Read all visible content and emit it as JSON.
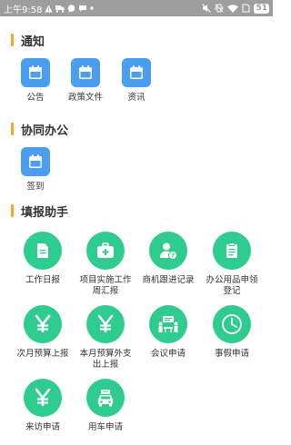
{
  "status_bar": {
    "time": "上午9:58",
    "battery": "51",
    "left_icons": [
      "warning-icon",
      "delivery-icon",
      "message-icon",
      "chat-icon",
      "more-dot-icon"
    ],
    "right_icons": [
      "mute-icon",
      "vibrate-icon",
      "wifi-icon",
      "sim-icon"
    ]
  },
  "sections": {
    "notice": {
      "title": "通知",
      "items": [
        {
          "label": "公告",
          "icon": "calendar-icon"
        },
        {
          "label": "政策文件",
          "icon": "calendar-icon"
        },
        {
          "label": "资讯",
          "icon": "calendar-icon"
        }
      ]
    },
    "office": {
      "title": "协同办公",
      "items": [
        {
          "label": "签到",
          "icon": "calendar-icon"
        }
      ]
    },
    "forms": {
      "title": "填报助手",
      "items": [
        {
          "label": "工作日报",
          "icon": "document-icon"
        },
        {
          "label": "项目实施工作周汇报",
          "icon": "medical-case-icon"
        },
        {
          "label": "商机跟进记录",
          "icon": "person-question-icon"
        },
        {
          "label": "办公用品申领登记",
          "icon": "clipboard-icon"
        },
        {
          "label": "次月预算上报",
          "icon": "yen-icon"
        },
        {
          "label": "本月预算外支出上报",
          "icon": "yen-icon"
        },
        {
          "label": "会议申请",
          "icon": "meeting-icon"
        },
        {
          "label": "事假申请",
          "icon": "clock-icon"
        },
        {
          "label": "来访申请",
          "icon": "yen-icon"
        },
        {
          "label": "用车申请",
          "icon": "car-icon"
        }
      ]
    }
  },
  "colors": {
    "status_bar": "#9e9e9e",
    "section_accent": "#f5a623",
    "blue_icon": "#4a9df0",
    "green_icon": "#2ecc8e"
  }
}
